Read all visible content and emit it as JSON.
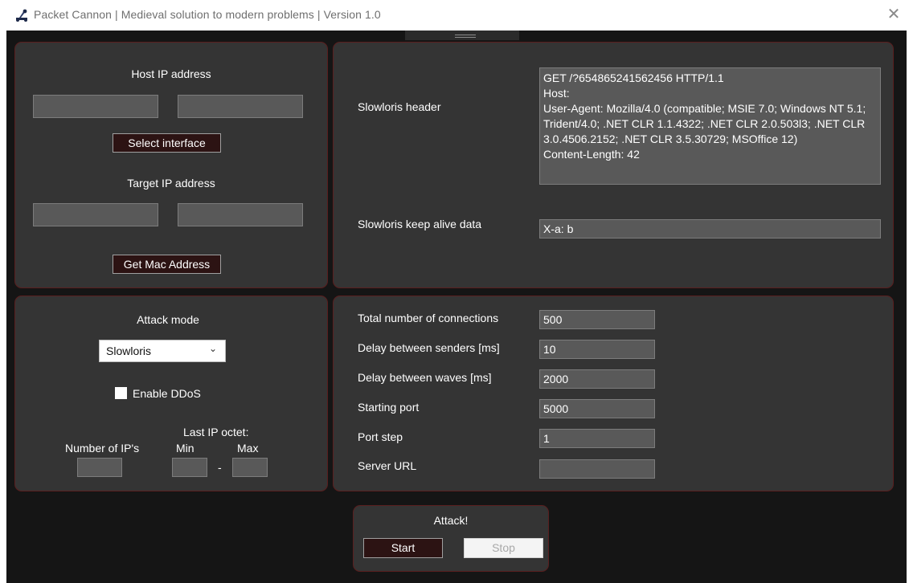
{
  "window": {
    "title": "Packet Cannon | Medieval solution to modern problems | Version 1.0",
    "close_glyph": "✕"
  },
  "network": {
    "host_label": "Host IP address",
    "host_ip": "",
    "host_mac": "",
    "select_interface_label": "Select interface",
    "target_label": "Target IP address",
    "target_ip": "",
    "target_mac": "",
    "get_mac_label": "Get Mac Address"
  },
  "slowloris": {
    "header_label": "Slowloris header",
    "header_value": "GET /?654865241562456 HTTP/1.1\nHost:\nUser-Agent: Mozilla/4.0 (compatible; MSIE 7.0; Windows NT 5.1; Trident/4.0; .NET CLR 1.1.4322; .NET CLR 2.0.503l3; .NET CLR 3.0.4506.2152; .NET CLR 3.5.30729; MSOffice 12)\nContent-Length: 42",
    "keepalive_label": "Slowloris keep alive data",
    "keepalive_value": "X-a: b"
  },
  "attack_mode": {
    "label": "Attack mode",
    "selected": "Slowloris",
    "enable_ddos_label": "Enable DDoS",
    "enable_ddos_checked": false,
    "last_octet_label": "Last IP octet:",
    "num_ips_label": "Number of IP's",
    "min_label": "Min",
    "max_label": "Max",
    "dash": "-",
    "num_ips_value": "",
    "min_value": "",
    "max_value": ""
  },
  "settings": {
    "total_connections_label": "Total number of connections",
    "total_connections_value": "500",
    "delay_senders_label": "Delay between senders [ms]",
    "delay_senders_value": "10",
    "delay_waves_label": "Delay between waves [ms]",
    "delay_waves_value": "2000",
    "starting_port_label": "Starting port",
    "starting_port_value": "5000",
    "port_step_label": "Port step",
    "port_step_value": "1",
    "server_url_label": "Server URL",
    "server_url_value": ""
  },
  "attack": {
    "title": "Attack!",
    "start_label": "Start",
    "stop_label": "Stop"
  },
  "colors": {
    "background": "#151515",
    "panel": "#343434",
    "panel_border": "#5a1f1f",
    "button": "#2c1313",
    "field": "#595959"
  }
}
